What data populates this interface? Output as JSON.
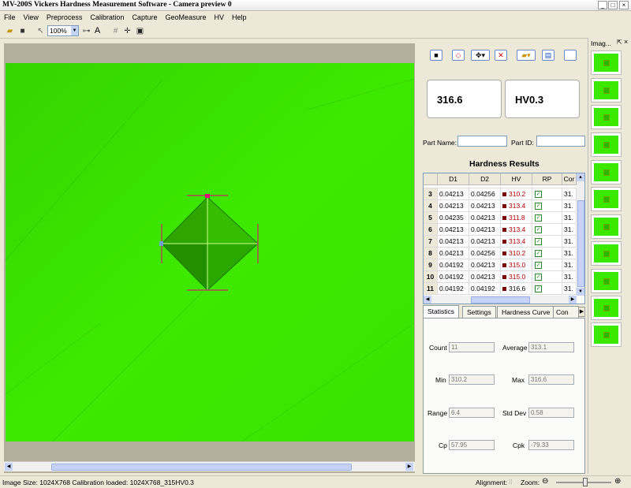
{
  "window": {
    "title": "MV-200S Vickers Hardness Measurement Software - Camera preview 0"
  },
  "menu": [
    "File",
    "View",
    "Preprocess",
    "Calibration",
    "Capture",
    "GeoMeasure",
    "HV",
    "Help"
  ],
  "toolbar": {
    "zoom": "100%",
    "text_tool": "A"
  },
  "readouts": {
    "value": "316.6",
    "scale": "HV0.3"
  },
  "part": {
    "name_label": "Part Name:",
    "name_value": "",
    "id_label": "Part ID:",
    "id_value": ""
  },
  "results": {
    "title": "Hardness Results",
    "columns": [
      "D1",
      "D2",
      "HV",
      "RP",
      "Cor"
    ],
    "rows": [
      {
        "n": "3",
        "d1": "0.04213",
        "d2": "0.04256",
        "hv": "310.2",
        "cor": "31.",
        "red": true
      },
      {
        "n": "4",
        "d1": "0.04213",
        "d2": "0.04213",
        "hv": "313.4",
        "cor": "31.",
        "red": true
      },
      {
        "n": "5",
        "d1": "0.04235",
        "d2": "0.04213",
        "hv": "311.8",
        "cor": "31.",
        "red": true
      },
      {
        "n": "6",
        "d1": "0.04213",
        "d2": "0.04213",
        "hv": "313.4",
        "cor": "31.",
        "red": true
      },
      {
        "n": "7",
        "d1": "0.04213",
        "d2": "0.04213",
        "hv": "313.4",
        "cor": "31.",
        "red": true
      },
      {
        "n": "8",
        "d1": "0.04213",
        "d2": "0.04256",
        "hv": "310.2",
        "cor": "31.",
        "red": true
      },
      {
        "n": "9",
        "d1": "0.04192",
        "d2": "0.04213",
        "hv": "315.0",
        "cor": "31.",
        "red": true
      },
      {
        "n": "10",
        "d1": "0.04192",
        "d2": "0.04213",
        "hv": "315.0",
        "cor": "31.",
        "red": true
      },
      {
        "n": "11",
        "d1": "0.04192",
        "d2": "0.04192",
        "hv": "316.6",
        "cor": "31.",
        "red": false
      }
    ]
  },
  "tabs": [
    "Statistics",
    "Settings",
    "Hardness Curve",
    "Con"
  ],
  "statistics": {
    "count_label": "Count",
    "count": "11",
    "average_label": "Average",
    "average": "313.1",
    "min_label": "Min",
    "min": "310.2",
    "max_label": "Max",
    "max": "316.6",
    "range_label": "Range",
    "range": "6.4",
    "stddev_label": "Std Dev",
    "stddev": "0.58",
    "cp_label": "Cp",
    "cp": "57.95",
    "cpk_label": "Cpk",
    "cpk": "-79.33"
  },
  "thumbnails": {
    "header": "Imag..."
  },
  "status": {
    "text": "Image Size: 1024X768  Calibration loaded: 1024X768_315HV0.3",
    "alignment_label": "Alignment:",
    "zoom_label": "Zoom:"
  },
  "colors": {
    "camera_bg": "#3ae800",
    "hv_red": "#b00000"
  }
}
